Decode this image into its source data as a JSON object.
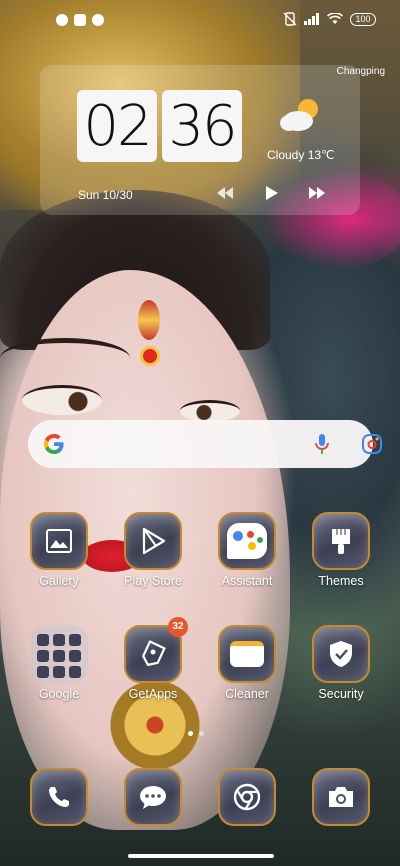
{
  "status_bar": {
    "battery": "100"
  },
  "clock_widget": {
    "location": "Changping",
    "hour": "02",
    "minute": "36",
    "weather": "Cloudy  13℃",
    "date": "Sun 10/30"
  },
  "search": {
    "icons": [
      "google-logo",
      "mic-icon",
      "lens-icon"
    ]
  },
  "apps_row1": [
    {
      "label": "Gallery",
      "icon": "gallery-icon"
    },
    {
      "label": "Play Store",
      "icon": "play-store-icon"
    },
    {
      "label": "Assistant",
      "icon": "assistant-icon"
    },
    {
      "label": "Themes",
      "icon": "themes-brush-icon"
    }
  ],
  "apps_row2": [
    {
      "label": "Google",
      "icon": "folder-icon"
    },
    {
      "label": "GetApps",
      "icon": "getapps-icon",
      "badge": "32"
    },
    {
      "label": "Cleaner",
      "icon": "cleaner-icon"
    },
    {
      "label": "Security",
      "icon": "shield-icon"
    }
  ],
  "dock": [
    {
      "icon": "phone-icon"
    },
    {
      "icon": "messages-icon"
    },
    {
      "icon": "chrome-icon"
    },
    {
      "icon": "camera-icon"
    }
  ],
  "colors": {
    "icon_border": "#c48a2c",
    "badge": "#e8572a"
  }
}
